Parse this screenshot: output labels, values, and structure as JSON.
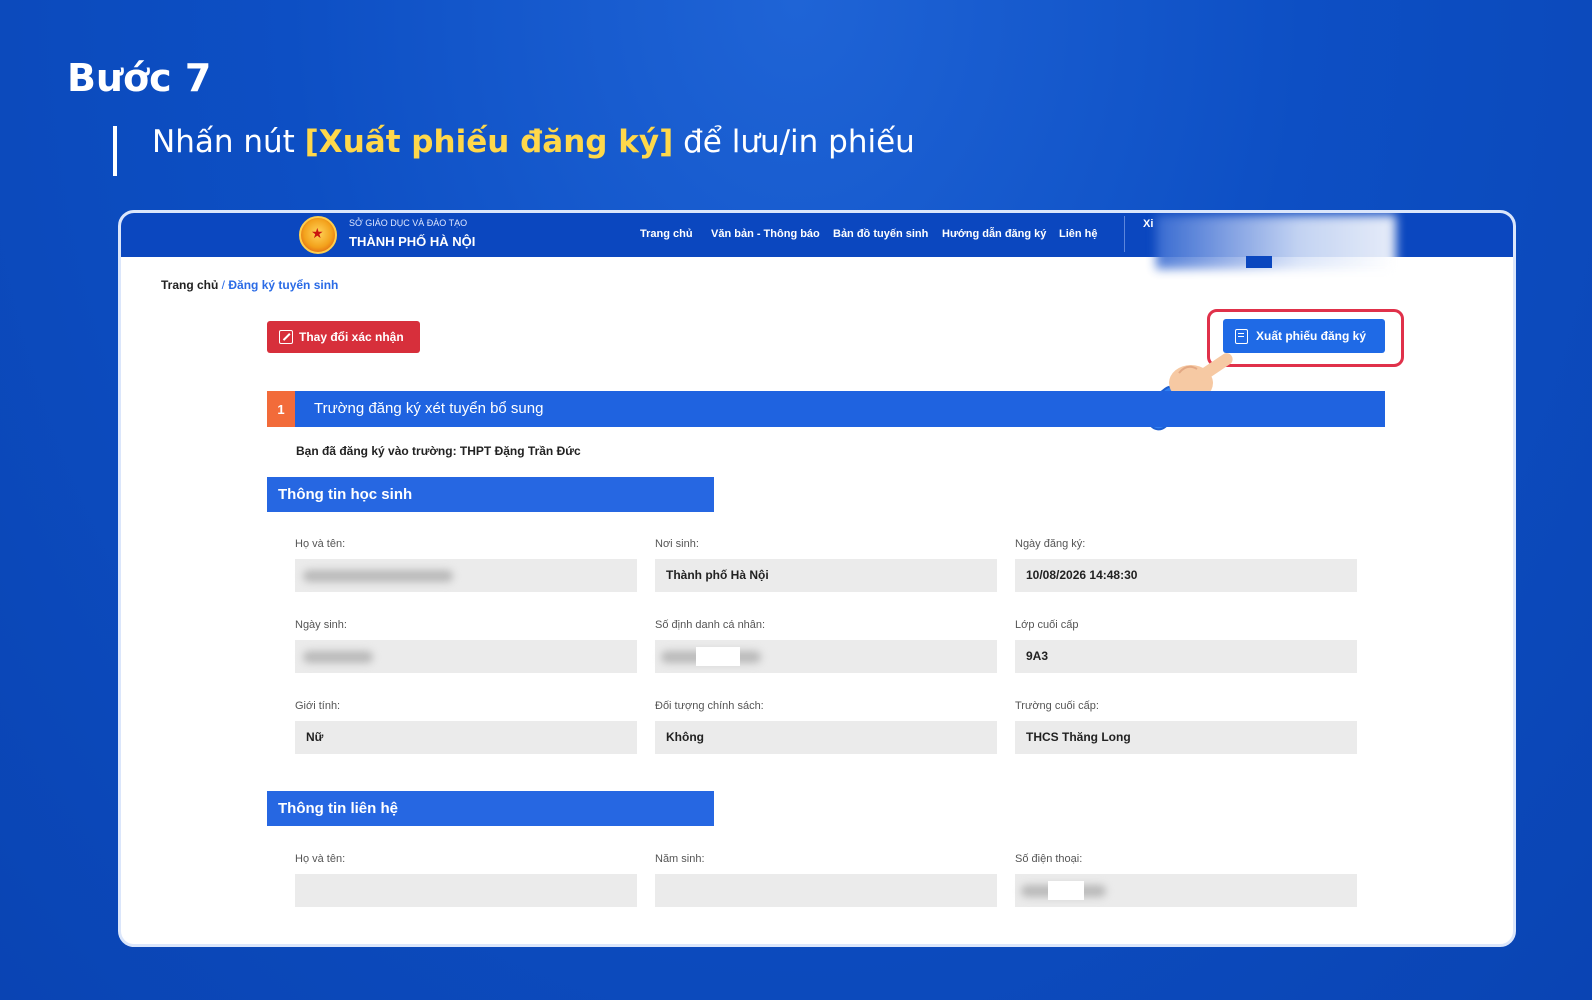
{
  "step": {
    "title": "Bước 7",
    "instruction_prefix": "Nhấn nút ",
    "instruction_highlight": "[Xuất phiếu đăng ký]",
    "instruction_suffix": " để lưu/in phiếu"
  },
  "header": {
    "org_line1": "SỞ GIÁO DỤC VÀ ĐÀO TẠO",
    "org_line2": "THÀNH PHỐ HÀ NỘI",
    "nav": [
      "Trang chủ",
      "Văn bản - Thông báo",
      "Bản đồ tuyến sinh",
      "Hướng dẫn đăng ký",
      "Liên hệ"
    ],
    "user_initials": "Xi"
  },
  "breadcrumb": {
    "home": "Trang chủ",
    "sep": " / ",
    "current": "Đăng ký tuyển sinh"
  },
  "actions": {
    "change_label": "Thay đổi xác nhận",
    "export_label": "Xuất phiếu đăng ký"
  },
  "section": {
    "number": "1",
    "title": "Trường đăng ký xét tuyển bổ sung",
    "registered_text": "Bạn đã đăng ký vào trường: THPT Đặng Trần Đức"
  },
  "student_info": {
    "header": "Thông tin học sinh",
    "fields": [
      {
        "label": "Họ và tên:",
        "value": ""
      },
      {
        "label": "Nơi sinh:",
        "value": "Thành phố Hà Nội"
      },
      {
        "label": "Ngày đăng ký:",
        "value": "10/08/2026 14:48:30"
      },
      {
        "label": "Ngày sinh:",
        "value": ""
      },
      {
        "label": "Số định danh cá nhân:",
        "value": ""
      },
      {
        "label": "Lớp cuối cấp",
        "value": "9A3"
      },
      {
        "label": "Giới tính:",
        "value": "Nữ"
      },
      {
        "label": "Đối tượng chính sách:",
        "value": "Không"
      },
      {
        "label": "Trường cuối cấp:",
        "value": "THCS Thăng Long"
      }
    ]
  },
  "contact_info": {
    "header": "Thông tin liên hệ",
    "fields": [
      {
        "label": "Họ và tên:",
        "value": ""
      },
      {
        "label": "Năm sinh:",
        "value": ""
      },
      {
        "label": "Số điện thoại:",
        "value": ""
      }
    ]
  },
  "colors": {
    "background": "#0d4fc4",
    "highlight_text": "#ffd84a",
    "nav_bar": "#0b47bf",
    "primary_button": "#1f6ae6",
    "danger_button": "#d72f3b",
    "section_number": "#f26b3a",
    "callout_border": "#e0314a"
  }
}
